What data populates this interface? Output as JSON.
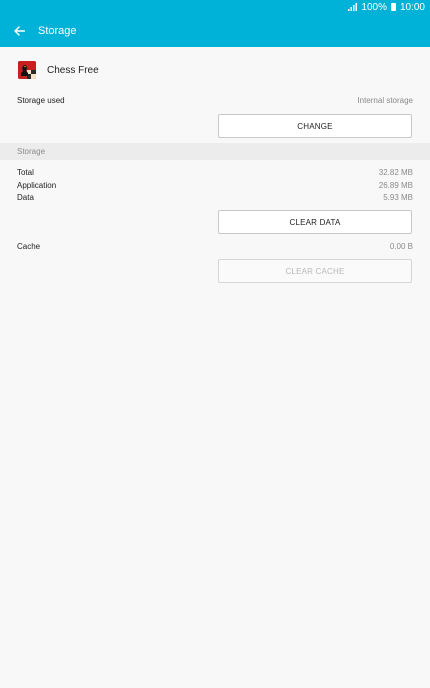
{
  "status_bar": {
    "battery": "100%",
    "time": "10:00"
  },
  "app_bar": {
    "title": "Storage"
  },
  "app": {
    "name": "Chess Free"
  },
  "storage_used": {
    "label": "Storage used",
    "value": "Internal storage"
  },
  "change_button": {
    "label": "CHANGE"
  },
  "storage_section": {
    "header": "Storage",
    "rows": [
      {
        "label": "Total",
        "value": "32.82 MB"
      },
      {
        "label": "Application",
        "value": "26.89 MB"
      },
      {
        "label": "Data",
        "value": "5.93 MB"
      }
    ]
  },
  "clear_data_button": {
    "label": "CLEAR DATA"
  },
  "cache": {
    "label": "Cache",
    "value": "0.00 B"
  },
  "clear_cache_button": {
    "label": "CLEAR CACHE",
    "enabled": false
  },
  "colors": {
    "accent": "#00b2d8",
    "section_bg": "#ececec",
    "background": "#f8f8f8"
  },
  "icons": [
    "signal-icon",
    "battery-icon",
    "back-arrow-icon",
    "chess-app-icon"
  ]
}
